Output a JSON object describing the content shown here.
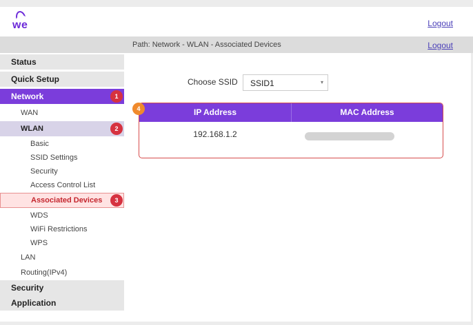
{
  "header": {
    "logo_text": "we",
    "logout_label": "Logout"
  },
  "pathbar": {
    "path": "Path: Network - WLAN - Associated Devices",
    "logout_label": "Logout"
  },
  "sidebar": {
    "items": [
      {
        "label": "Status"
      },
      {
        "label": "Quick Setup"
      },
      {
        "label": "Network",
        "badge": "1"
      },
      {
        "label": "WAN"
      },
      {
        "label": "WLAN",
        "badge": "2"
      },
      {
        "label": "Basic"
      },
      {
        "label": "SSID Settings"
      },
      {
        "label": "Security"
      },
      {
        "label": "Access Control List"
      },
      {
        "label": "Associated Devices",
        "badge": "3"
      },
      {
        "label": "WDS"
      },
      {
        "label": "WiFi Restrictions"
      },
      {
        "label": "WPS"
      },
      {
        "label": "LAN"
      },
      {
        "label": "Routing(IPv4)"
      },
      {
        "label": "Security"
      },
      {
        "label": "Application"
      }
    ]
  },
  "main": {
    "ssid_label": "Choose SSID",
    "ssid_value": "SSID1",
    "table_badge": "4",
    "table": {
      "columns": [
        "IP Address",
        "MAC Address"
      ],
      "rows": [
        {
          "ip": "192.168.1.2",
          "mac": ""
        }
      ]
    }
  },
  "colors": {
    "accent_purple": "#7b3ddb",
    "badge_red": "#d63240",
    "badge_orange": "#f08a2c",
    "highlight_border": "#d64b4b"
  }
}
